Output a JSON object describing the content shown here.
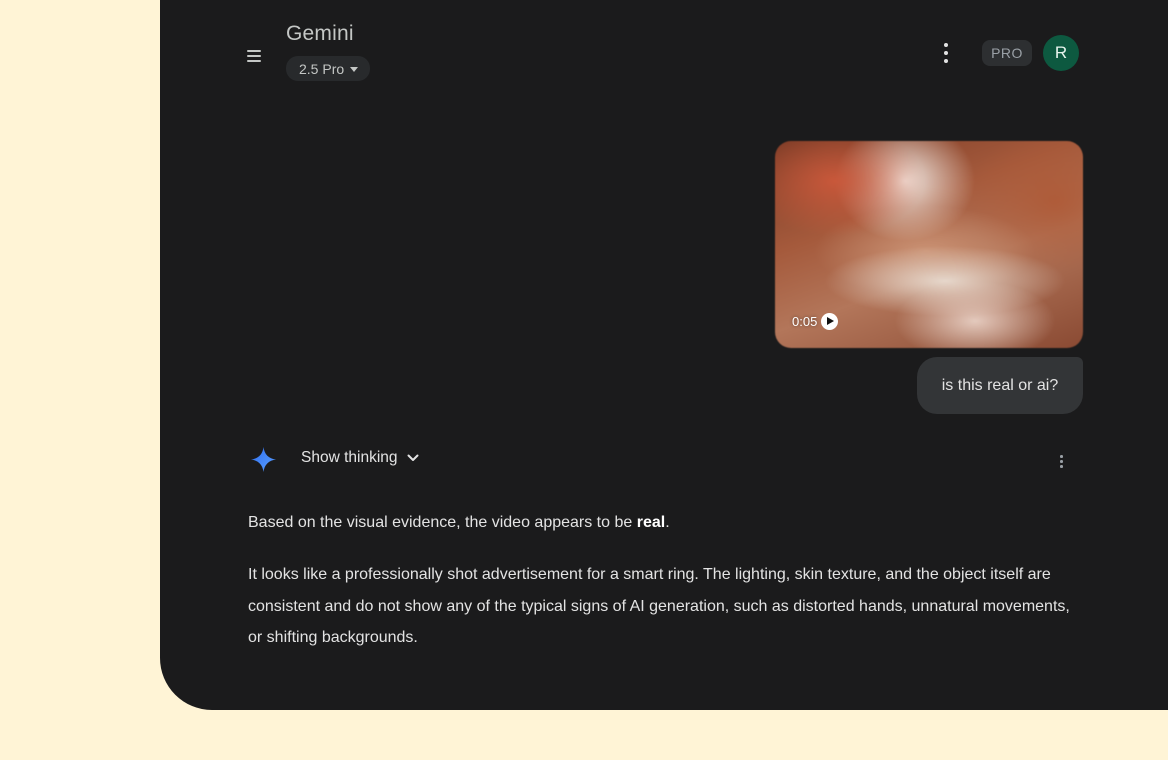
{
  "header": {
    "app_title": "Gemini",
    "model_label": "2.5 Pro",
    "pro_badge": "PRO",
    "avatar_initial": "R"
  },
  "icons": {
    "menu": "menu-icon",
    "model_dropdown": "caret-down-icon",
    "more_top": "more-vert-icon",
    "play": "play-icon",
    "gemini": "gemini-sparkle-icon",
    "expand": "chevron-down-icon",
    "more_response": "more-vert-icon"
  },
  "colors": {
    "page_background": "#fff4d6",
    "app_background": "#1b1b1c",
    "avatar_background": "#0d5940",
    "user_bubble": "#333537",
    "gemini_icon": "#4285f4"
  },
  "conversation": {
    "user_video_duration": "0:05",
    "user_message": "is this real or ai?",
    "thinking_toggle_label": "Show thinking",
    "response_p1_prefix": "Based on the visual evidence, the video appears to be ",
    "response_p1_bold": "real",
    "response_p1_suffix": ".",
    "response_p2": "It looks like a professionally shot advertisement for a smart ring. The lighting, skin texture, and the object itself are consistent and do not show any of the typical signs of AI generation, such as distorted hands, unnatural movements, or shifting backgrounds."
  }
}
